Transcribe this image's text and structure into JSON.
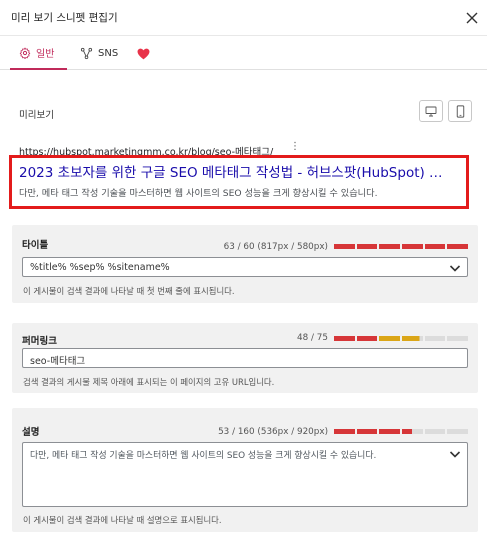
{
  "header": {
    "title": "미리 보기 스니펫 편집기"
  },
  "tabs": [
    {
      "label": "일반",
      "icon": "gear-icon"
    },
    {
      "label": "SNS",
      "icon": "share-icon"
    },
    {
      "label": "",
      "icon": "heart-icon"
    }
  ],
  "colors": {
    "accent": "#c02a5a",
    "link": "#1a0dab",
    "highlight_border": "#e31b1b",
    "bar_red": "#d63638",
    "bar_orange": "#dba617",
    "bar_empty": "#dcdcdc"
  },
  "preview": {
    "label": "미리보기",
    "url": "https://hubspot.marketingmm.co.kr/blog/seo-메타태그/",
    "url_menu": "⋮",
    "title": "2023 초보자를 위한 구글 SEO 메타태그 작성법 - 허브스팟(HubSpot) …",
    "description": "다만, 메타 태그 작성 기술을 마스터하면 웹 사이트의 SEO 성능을 크게 향상시킬 수 있습니다."
  },
  "title_field": {
    "label": "타이틀",
    "count": "63 / 60 (817px / 580px)",
    "progress_fraction": 1.0,
    "value": "%title% %sep% %sitename%",
    "help": "이 게시물이 검색 결과에 나타날 때 첫 번째 줄에 표시됩니다."
  },
  "permalink_field": {
    "label": "퍼머링크",
    "count": "48 / 75",
    "progress_fraction": 0.64,
    "value": "seo-메타태그",
    "help": "검색 결과의 게시물 제목 아래에 표시되는 이 페이지의 고유 URL입니다."
  },
  "description_field": {
    "label": "설명",
    "count": "53 / 160 (536px / 920px)",
    "progress_fraction": 0.58,
    "value": "다만, 메타 태그 작성 기술을 마스터하면 웹 사이트의 SEO 성능을 크게 향상시킬 수 있습니다.",
    "help": "이 게시물이 검색 결과에 나타날 때 설명으로 표시됩니다."
  }
}
